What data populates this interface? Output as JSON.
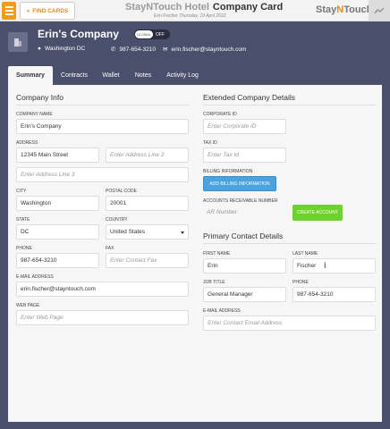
{
  "topbar": {
    "find_cards": "FIND CARDS",
    "hotel_name": "StayNTouch Hotel",
    "card_title": "Company Card",
    "user": "Erin Fischer",
    "date": "Thursday, 19 April 2022",
    "brand_a": "Stay",
    "brand_b": "N",
    "brand_c": "Touch"
  },
  "header": {
    "company_name": "Erin's Company",
    "toggle_on": "GLOBAL",
    "toggle_off": "OFF",
    "location": "Washington   DC",
    "phone": "987-654-3210",
    "email": "erin.fischer@stayntouch.com"
  },
  "tabs": [
    "Summary",
    "Contracts",
    "Wallet",
    "Notes",
    "Activity Log"
  ],
  "company_info": {
    "title": "Company Info",
    "company_name_label": "COMPANY NAME",
    "company_name": "Erin's Company",
    "address_label": "ADDRESS",
    "address1": "12345 Main Street",
    "address2_placeholder": "Enter Address Line 2",
    "address3_placeholder": "Enter Address Line 3",
    "city_label": "CITY",
    "city": "Washington",
    "postal_label": "POSTAL CODE",
    "postal": "20001",
    "state_label": "STATE",
    "state": "DC",
    "country_label": "COUNTRY",
    "country": "United States",
    "phone_label": "PHONE",
    "phone": "987-654-3210",
    "fax_label": "FAX",
    "fax_placeholder": "Enter Contact Fax",
    "email_label": "E-MAIL ADDRESS",
    "email": "erin.fischer@stayntouch.com",
    "webpage_label": "WEB PAGE",
    "webpage_placeholder": "Enter Web Page"
  },
  "extended": {
    "title": "Extended Company Details",
    "corporate_id_label": "CORPORATE ID",
    "corporate_id_placeholder": "Enter Corporate ID",
    "tax_id_label": "TAX ID",
    "tax_id_placeholder": "Enter Tax Id",
    "billing_label": "BILLING INFORMATION",
    "billing_button": "ADD BILLING INFORMATION",
    "ar_label": "ACCOUNTS RECEIVABLE NUMBER",
    "ar_placeholder": "AR Number",
    "create_account": "CREATE ACCOUNT"
  },
  "contact": {
    "title": "Primary Contact Details",
    "first_name_label": "FIRST NAME",
    "first_name": "Erin",
    "last_name_label": "LAST NAME",
    "last_name": "Fischer",
    "job_title_label": "JOB TITLE",
    "job_title": "General Manager",
    "phone_label": "PHONE",
    "phone": "987-654-3210",
    "email_label": "E-MAIL ADDRESS",
    "email_placeholder": "Enter Contact Email Address"
  }
}
